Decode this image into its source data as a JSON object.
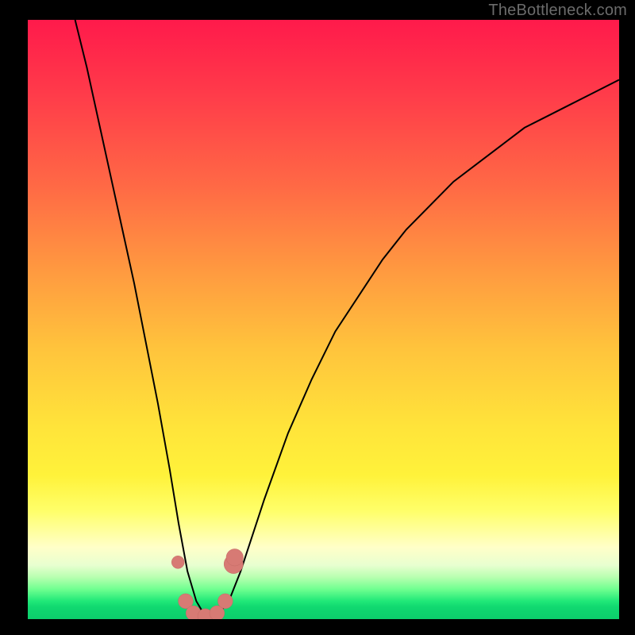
{
  "watermark": "TheBottleneck.com",
  "colors": {
    "frame": "#000000",
    "curve": "#000000",
    "marker_fill": "#d77a74",
    "marker_stroke": "#c46a64"
  },
  "chart_data": {
    "type": "line",
    "title": "",
    "xlabel": "",
    "ylabel": "",
    "xlim": [
      0,
      100
    ],
    "ylim": [
      0,
      100
    ],
    "grid": false,
    "legend": false,
    "series": [
      {
        "name": "bottleneck-curve",
        "x": [
          8,
          10,
          12,
          14,
          16,
          18,
          20,
          22,
          24,
          25.5,
          27,
          28.5,
          30,
          32,
          34,
          36,
          38,
          40,
          44,
          48,
          52,
          56,
          60,
          64,
          68,
          72,
          76,
          80,
          84,
          88,
          92,
          96,
          100
        ],
        "y": [
          100,
          92,
          83,
          74,
          65,
          56,
          46,
          36,
          25,
          16,
          8,
          3,
          0.5,
          0.5,
          3,
          8,
          14,
          20,
          31,
          40,
          48,
          54,
          60,
          65,
          69,
          73,
          76,
          79,
          82,
          84,
          86,
          88,
          90
        ]
      }
    ],
    "markers": [
      {
        "x": 25.4,
        "y": 9.5,
        "r": 1.2
      },
      {
        "x": 26.7,
        "y": 3.0,
        "r": 1.4
      },
      {
        "x": 28.0,
        "y": 1.0,
        "r": 1.4
      },
      {
        "x": 30.0,
        "y": 0.5,
        "r": 1.4
      },
      {
        "x": 32.0,
        "y": 1.0,
        "r": 1.4
      },
      {
        "x": 33.4,
        "y": 3.0,
        "r": 1.4
      },
      {
        "x": 34.8,
        "y": 9.2,
        "r": 1.8
      },
      {
        "x": 35.0,
        "y": 10.3,
        "r": 1.6
      }
    ]
  }
}
